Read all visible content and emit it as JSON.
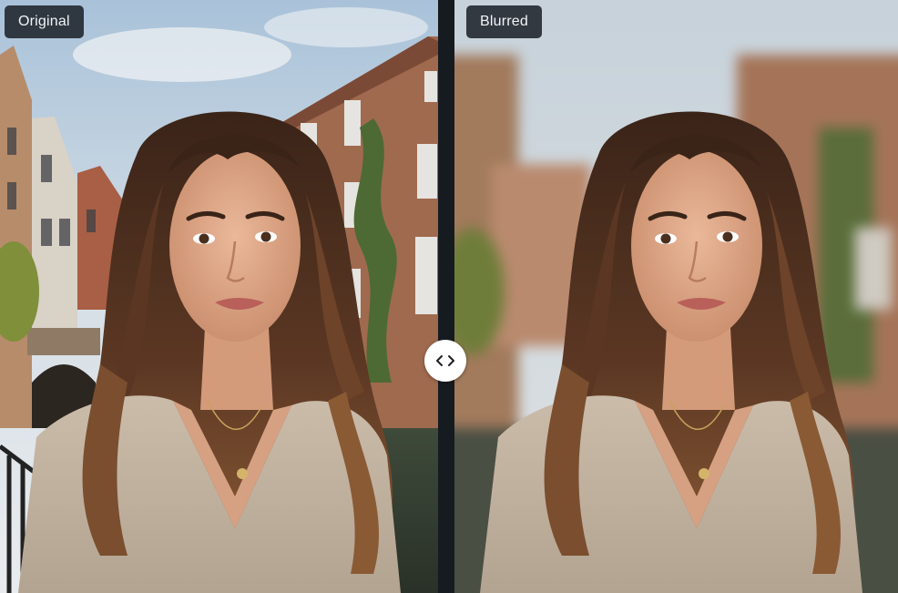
{
  "labels": {
    "original": "Original",
    "blurred": "Blurred"
  },
  "handle": {
    "icon": "chevron-left-right-icon"
  },
  "colors": {
    "chip_bg": "#1e232a",
    "chip_text": "#f2f4f6",
    "divider": "#161b20",
    "handle": "#ffffff"
  }
}
